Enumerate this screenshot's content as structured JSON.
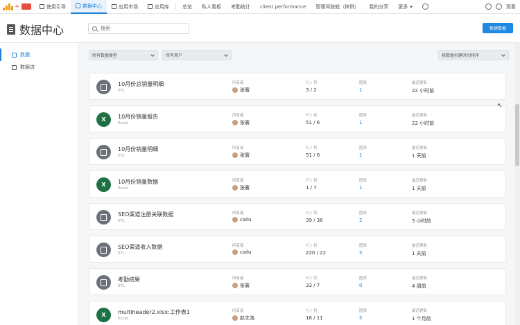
{
  "topbar": {
    "nav": [
      {
        "label": "使用引导",
        "active": false
      },
      {
        "label": "数据中心",
        "active": true
      },
      {
        "label": "应用市场",
        "active": false
      },
      {
        "label": "应用库",
        "active": false
      }
    ],
    "links": [
      "总览",
      "私人看板",
      "考勤统计",
      "client performance",
      "管理驾驶舱（样例）",
      "我的分享",
      "更多"
    ],
    "right_label": "观看"
  },
  "header": {
    "title": "数据中心",
    "search_placeholder": "搜索",
    "new_button": "新建数据"
  },
  "sidebar": {
    "items": [
      {
        "label": "数据",
        "active": true
      },
      {
        "label": "数据流",
        "active": false
      }
    ]
  },
  "filters": {
    "type": "所有数据类型",
    "user": "所有用户",
    "sort": "按数据创建时间排序"
  },
  "columns": {
    "owner": "所有者",
    "rowscols": "行 / 列",
    "charts": "图表",
    "updated": "最近更新"
  },
  "datasets": [
    {
      "name": "10月份总销量明细",
      "type": "ETL",
      "kind": "etl",
      "owner": "张寰",
      "rows": "3 / 2",
      "charts": "1",
      "updated": "22 小时前"
    },
    {
      "name": "10月份销量报告",
      "type": "Excel",
      "kind": "excel",
      "owner": "张寰",
      "rows": "51 / 6",
      "charts": "1",
      "updated": "22 小时前"
    },
    {
      "name": "10月份销量明细",
      "type": "ETL",
      "kind": "etl",
      "owner": "张寰",
      "rows": "51 / 6",
      "charts": "1",
      "updated": "1 天前"
    },
    {
      "name": "10月份销量数据",
      "type": "Excel",
      "kind": "excel",
      "owner": "张寰",
      "rows": "1 / 7",
      "charts": "1",
      "updated": "1 天前"
    },
    {
      "name": "SEO渠道注册关联数据",
      "type": "ETL",
      "kind": "etl",
      "owner": "cailu",
      "rows": "39 / 38",
      "charts": "2",
      "updated": "5 小时前"
    },
    {
      "name": "SEO渠道收入数据",
      "type": "ETL",
      "kind": "etl",
      "owner": "cailu",
      "rows": "220 / 22",
      "charts": "5",
      "updated": "1 天前"
    },
    {
      "name": "考勤结果",
      "type": "ETL",
      "kind": "etl",
      "owner": "张寰",
      "rows": "33 / 7",
      "charts": "0",
      "updated": "4 周前"
    },
    {
      "name": "multiheader2.xlsx:工作表1",
      "type": "Excel",
      "kind": "excel",
      "owner": "赵文浩",
      "rows": "16 / 11",
      "charts": "5",
      "updated": "1 个月前"
    }
  ],
  "colors": {
    "accent": "#1f7fd6",
    "excel": "#1e7145",
    "etl": "#6b7079"
  }
}
